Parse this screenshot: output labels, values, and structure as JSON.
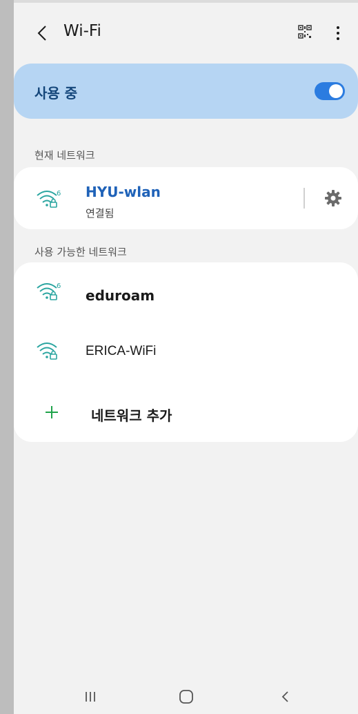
{
  "header": {
    "title": "Wi-Fi",
    "back_icon": "chevron-left-icon",
    "qr_icon": "qr-code-icon",
    "more_icon": "more-vertical-icon"
  },
  "toggle": {
    "label": "사용 중",
    "state": true,
    "color": "#2b7ce0"
  },
  "current_section": {
    "label": "현재 네트워크",
    "network": {
      "name": "HYU-wlan",
      "status": "연결됨",
      "wifi_badge": "6",
      "icon": "wifi-6-lock-icon",
      "settings_icon": "gear-icon"
    }
  },
  "available_section": {
    "label": "사용 가능한 네트워크",
    "networks": [
      {
        "name": "eduroam",
        "wifi_badge": "6",
        "icon": "wifi-6-lock-icon"
      },
      {
        "name": "ERICA-WiFi",
        "icon": "wifi-lock-icon"
      }
    ],
    "add_label": "네트워크 추가",
    "add_icon": "plus-icon"
  },
  "nav": {
    "recents_icon": "recents-icon",
    "home_icon": "home-icon",
    "back_icon": "back-icon"
  }
}
